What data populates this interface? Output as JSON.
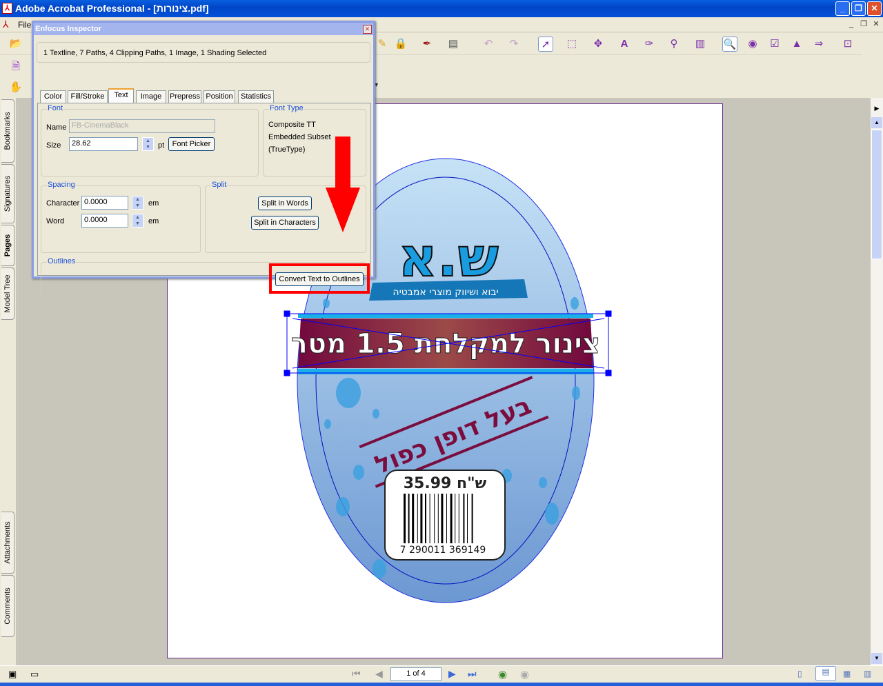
{
  "window": {
    "title": "Adobe Acrobat Professional - [צינורות.pdf]"
  },
  "menu": {
    "file": "File"
  },
  "nav_tabs": [
    "Bookmarks",
    "Signatures",
    "Pages",
    "Model Tree",
    "Attachments",
    "Comments"
  ],
  "inspector": {
    "title": "Enfocus Inspector",
    "selection": "1 Textline, 7 Paths, 4 Clipping Paths, 1 Image, 1 Shading Selected",
    "tabs": [
      "Color",
      "Fill/Stroke",
      "Text",
      "Image",
      "Prepress",
      "Position",
      "Statistics"
    ],
    "active_tab": "Text",
    "font": {
      "group": "Font",
      "name_label": "Name",
      "name_value": "FB-CinemaBlack",
      "size_label": "Size",
      "size_value": "28.62",
      "unit": "pt",
      "picker_button": "Font Picker"
    },
    "font_type": {
      "group": "Font Type",
      "line1": "Composite TT",
      "line2": "Embedded Subset",
      "line3": "(TrueType)"
    },
    "spacing": {
      "group": "Spacing",
      "char_label": "Character",
      "char_value": "0.0000",
      "word_label": "Word",
      "word_value": "0.0000",
      "unit": "em"
    },
    "split": {
      "group": "Split",
      "words_button": "Split in Words",
      "chars_button": "Split in Characters"
    },
    "outlines": {
      "group": "Outlines",
      "convert_button": "Convert Text to Outlines"
    }
  },
  "label": {
    "logo": "ש.א",
    "tagline": "יבוא ושיווק מוצרי אמבטיה",
    "banner": "צינור למקלחת 1.5 מטר",
    "feature": "בעל דופן כפול",
    "price": "35.99 ש\"ח",
    "barcode": "7 290011 369149"
  },
  "status": {
    "page": "1 of 4"
  },
  "colors": {
    "accent": "#ff0000",
    "banner": "#7a0d3d",
    "selection": "#0000ff"
  }
}
